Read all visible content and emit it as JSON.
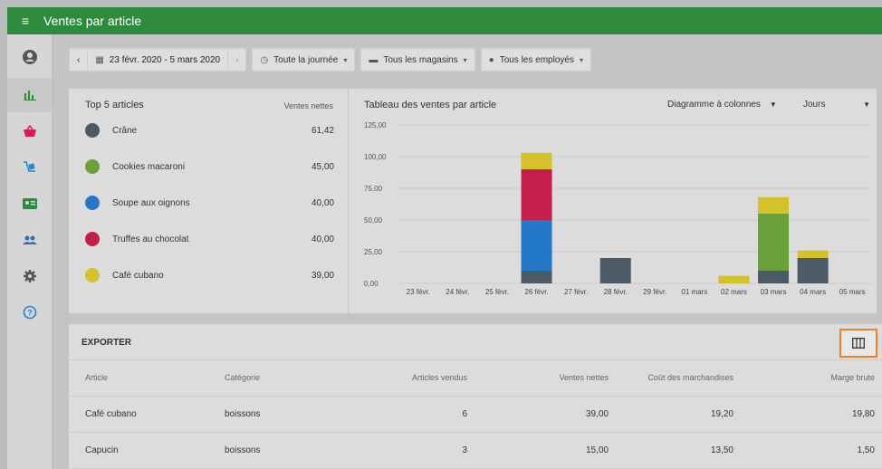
{
  "app": {
    "title": "Ventes par article"
  },
  "toolbar": {
    "prev": "‹",
    "next": "›",
    "date_range": "23 févr. 2020 - 5 mars 2020",
    "time_filter": "Toute la journée",
    "store_filter": "Tous les magasins",
    "employee_filter": "Tous les employés"
  },
  "top5": {
    "title": "Top 5 articles",
    "column_label": "Ventes nettes",
    "items": [
      {
        "name": "Crâne",
        "value": "61,42",
        "color": "#4a5a66"
      },
      {
        "name": "Cookies macaroni",
        "value": "45,00",
        "color": "#6aa03a"
      },
      {
        "name": "Soupe aux oignons",
        "value": "40,00",
        "color": "#2478c8"
      },
      {
        "name": "Truffes au chocolat",
        "value": "40,00",
        "color": "#c41e4a"
      },
      {
        "name": "Café cubano",
        "value": "39,00",
        "color": "#d4c22a"
      }
    ]
  },
  "chart_panel": {
    "title": "Tableau des ventes par article",
    "chart_type_select": "Diagramme à colonnes",
    "period_select": "Jours"
  },
  "chart_data": {
    "type": "bar",
    "stacked": true,
    "categories": [
      "23 févr.",
      "24 févr.",
      "25 févr.",
      "26 févr.",
      "27 févr.",
      "28 févr.",
      "29 févr.",
      "01 mars",
      "02 mars",
      "03 mars",
      "04 mars",
      "05 mars"
    ],
    "y_ticks": [
      "0,00",
      "25,00",
      "50,00",
      "75,00",
      "100,00",
      "125,00"
    ],
    "ylim": [
      0,
      125
    ],
    "series": [
      {
        "color": "#4a5a66",
        "values": [
          0,
          0,
          0,
          10,
          0,
          20,
          0,
          0,
          0,
          10,
          20,
          0
        ]
      },
      {
        "color": "#2478c8",
        "values": [
          0,
          0,
          0,
          40,
          0,
          0,
          0,
          0,
          0,
          0,
          0,
          0
        ]
      },
      {
        "color": "#c41e4a",
        "values": [
          0,
          0,
          0,
          40,
          0,
          0,
          0,
          0,
          0,
          0,
          0,
          0
        ]
      },
      {
        "color": "#6aa03a",
        "values": [
          0,
          0,
          0,
          0,
          0,
          0,
          0,
          0,
          0,
          45,
          0,
          0
        ]
      },
      {
        "color": "#d4c22a",
        "values": [
          0,
          0,
          0,
          13,
          0,
          0,
          0,
          0,
          6,
          13,
          6,
          0
        ]
      }
    ],
    "grid": true
  },
  "export": {
    "title": "EXPORTER",
    "columns": [
      "Article",
      "Catégorie",
      "Articles vendus",
      "Ventes nettes",
      "Coût des marchandises",
      "Marge brute"
    ],
    "rows": [
      [
        "Café cubano",
        "boissons",
        "6",
        "39,00",
        "19,20",
        "19,80"
      ],
      [
        "Capucin",
        "boissons",
        "3",
        "15,00",
        "13,50",
        "1,50"
      ]
    ]
  }
}
